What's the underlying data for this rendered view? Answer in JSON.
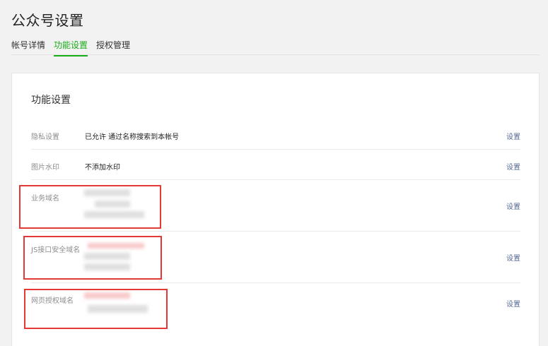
{
  "page_title": "公众号设置",
  "tabs": [
    {
      "label": "帐号详情"
    },
    {
      "label": "功能设置"
    },
    {
      "label": "授权管理"
    }
  ],
  "section_title": "功能设置",
  "rows": [
    {
      "label": "隐私设置",
      "value": "已允许 通过名称搜索到本帐号",
      "action": "设置"
    },
    {
      "label": "图片水印",
      "value": "不添加水印",
      "action": "设置"
    },
    {
      "label": "业务域名",
      "value": "",
      "action": "设置"
    },
    {
      "label": "JS接口安全域名",
      "value": "",
      "action": "设置"
    },
    {
      "label": "网页授权域名",
      "value": "",
      "action": "设置"
    }
  ],
  "colors": {
    "accent_green": "#1aad19",
    "link_blue": "#576b95",
    "highlight_red": "#e53935"
  }
}
